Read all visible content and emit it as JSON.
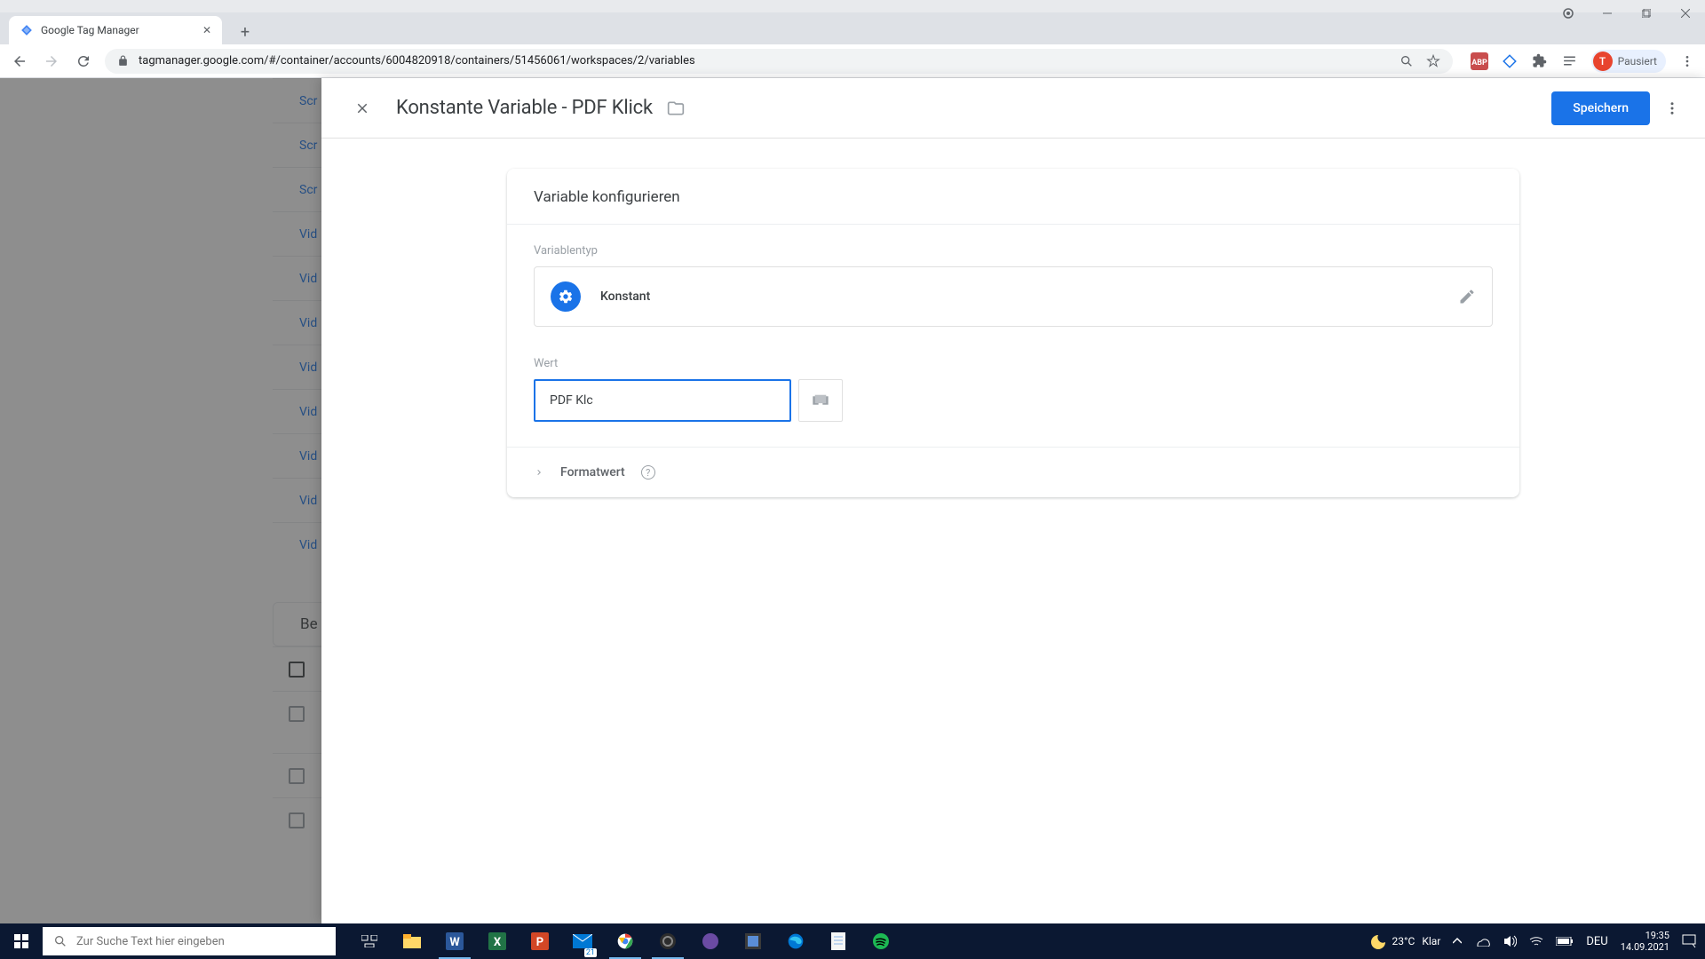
{
  "browser": {
    "tab_title": "Google Tag Manager",
    "url": "tagmanager.google.com/#/container/accounts/6004820918/containers/51456061/workspaces/2/variables",
    "profile_label": "Pausiert",
    "profile_initial": "T"
  },
  "background": {
    "rows": [
      "Scr",
      "Scr",
      "Scr",
      "Vid",
      "Vid",
      "Vid",
      "Vid",
      "Vid",
      "Vid",
      "Vid",
      "Vid"
    ],
    "section_label": "Be"
  },
  "panel": {
    "title": "Konstante Variable - PDF Klick",
    "save_label": "Speichern",
    "card_title": "Variable konfigurieren",
    "type_label": "Variablentyp",
    "type_value": "Konstant",
    "wert_label": "Wert",
    "wert_value": "PDF Klc",
    "format_label": "Formatwert"
  },
  "taskbar": {
    "search_placeholder": "Zur Suche Text hier eingeben",
    "weather_temp": "23°C",
    "weather_desc": "Klar",
    "lang": "DEU",
    "time": "19:35",
    "date": "14.09.2021",
    "calendar_badge": "21"
  }
}
